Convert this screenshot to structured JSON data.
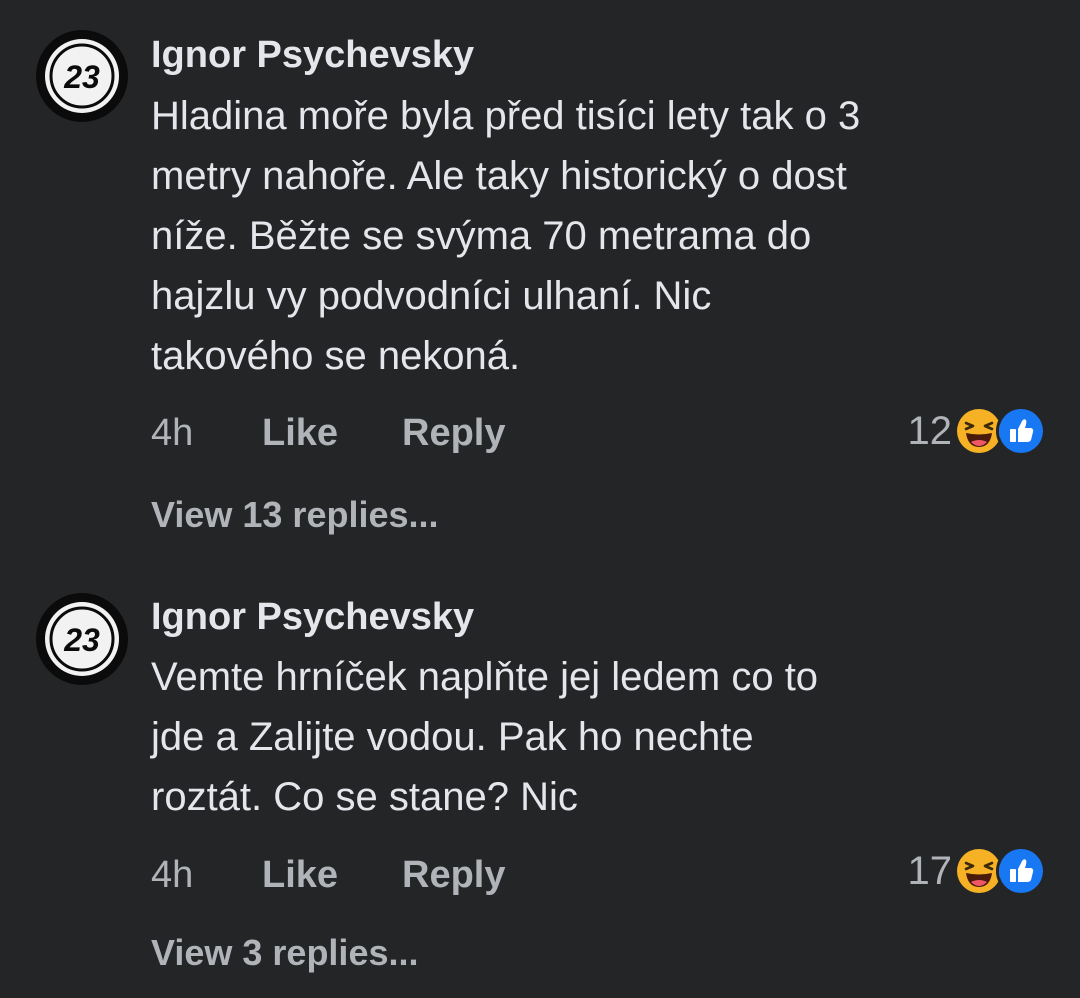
{
  "comments": [
    {
      "author": "Ignor Psychevsky",
      "avatar_text": "23",
      "avatar_icon": "number-23-avatar",
      "body_lines": [
        "Hladina moře byla před tisíci lety tak o 3",
        "metry nahoře. Ale taky historický o dost",
        "níže. Běžte se svýma 70 metrama do",
        "hajzlu vy podvodníci ulhaní. Nic",
        "takového se nekoná."
      ],
      "time": "4h",
      "like_label": "Like",
      "reply_label": "Reply",
      "reaction_count": "12",
      "reaction_icons": [
        "haha-icon",
        "like-icon"
      ],
      "view_replies": "View 13 replies..."
    },
    {
      "author": "Ignor Psychevsky",
      "avatar_text": "23",
      "avatar_icon": "number-23-avatar",
      "body_lines": [
        "Vemte hrníček naplňte jej ledem co to",
        "jde a Zalijte vodou. Pak ho nechte",
        "roztát. Co se stane? Nic"
      ],
      "time": "4h",
      "like_label": "Like",
      "reply_label": "Reply",
      "reaction_count": "17",
      "reaction_icons": [
        "haha-icon",
        "like-icon"
      ],
      "view_replies": "View 3 replies..."
    }
  ],
  "colors": {
    "background": "#242526",
    "primary_text": "#e4e6eb",
    "secondary_text": "#b0b3b8",
    "haha_yellow": "#f7b125",
    "like_blue": "#1877f2"
  }
}
